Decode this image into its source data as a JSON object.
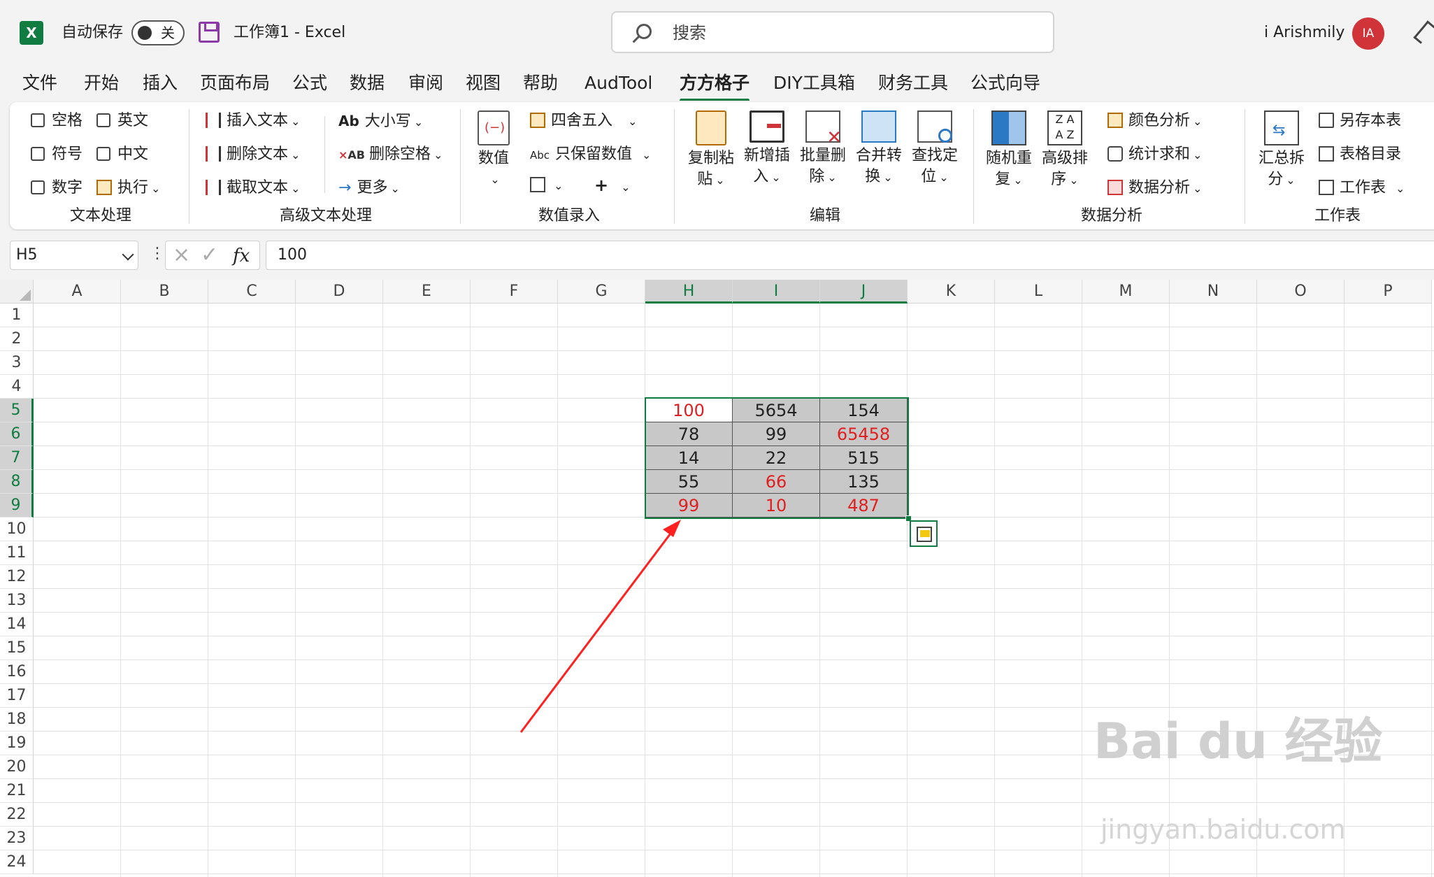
{
  "title_bar": {
    "app_icon": "excel-icon",
    "autosave_label": "自动保存",
    "autosave_state": "关",
    "doc_title": "工作簿1  -  Excel",
    "search_placeholder": "搜索",
    "user_name": "i Arishmily",
    "avatar_initials": "IA",
    "avatar_color": "#d13438"
  },
  "menu_tabs": [
    "文件",
    "开始",
    "插入",
    "页面布局",
    "公式",
    "数据",
    "审阅",
    "视图",
    "帮助",
    "AudTool",
    "方方格子",
    "DIY工具箱",
    "财务工具",
    "公式向导"
  ],
  "active_tab": "方方格子",
  "ribbon": {
    "text_processing": {
      "checkboxes": [
        "空格",
        "英文",
        "符号",
        "中文",
        "数字"
      ],
      "execute": "执行",
      "group_label": "文本处理"
    },
    "advanced_text": {
      "insert_text": "插入文本",
      "delete_text": "删除文本",
      "extract_text": "截取文本",
      "case": "大小写",
      "delete_spaces": "删除空格",
      "more": "更多",
      "group_label": "高级文本处理"
    },
    "number_entry": {
      "number": "数值",
      "round": "四舍五入",
      "keep_number": "只保留数值",
      "group_label": "数值录入"
    },
    "edit": {
      "copy_paste_a": "复制粘",
      "copy_paste_b": "贴",
      "add_insert_a": "新增插",
      "add_insert_b": "入",
      "batch_delete_a": "批量删",
      "batch_delete_b": "除",
      "merge_a": "合并转",
      "merge_b": "换",
      "find_a": "查找定",
      "find_b": "位",
      "group_label": "编辑"
    },
    "data_analysis": {
      "random_a": "随机重",
      "random_b": "复",
      "sort_a": "高级排",
      "sort_b": "序",
      "color_analysis": "颜色分析",
      "stat_sum": "统计求和",
      "data_analysis": "数据分析",
      "group_label": "数据分析"
    },
    "worksheet": {
      "summary_a": "汇总拆",
      "summary_b": "分",
      "save_sheet": "另存本表",
      "sheet_index": "表格目录",
      "worksheet": "工作表",
      "group_label": "工作表"
    }
  },
  "formula_bar": {
    "name_box": "H5",
    "value": "100"
  },
  "columns": [
    "A",
    "B",
    "C",
    "D",
    "E",
    "F",
    "G",
    "H",
    "I",
    "J",
    "K",
    "L",
    "M",
    "N",
    "O",
    "P"
  ],
  "rows": [
    "1",
    "2",
    "3",
    "4",
    "5",
    "6",
    "7",
    "8",
    "9",
    "10",
    "11",
    "12",
    "13",
    "14",
    "15",
    "16",
    "17",
    "18",
    "19",
    "20",
    "21",
    "22",
    "23",
    "24"
  ],
  "selected_range": "H5:J9",
  "cells": [
    {
      "ref": "H5",
      "value": "100",
      "color": "#e02020"
    },
    {
      "ref": "I5",
      "value": "5654",
      "color": "#222222"
    },
    {
      "ref": "J5",
      "value": "154",
      "color": "#222222"
    },
    {
      "ref": "H6",
      "value": "78",
      "color": "#222222"
    },
    {
      "ref": "I6",
      "value": "99",
      "color": "#222222"
    },
    {
      "ref": "J6",
      "value": "65458",
      "color": "#e02020"
    },
    {
      "ref": "H7",
      "value": "14",
      "color": "#222222"
    },
    {
      "ref": "I7",
      "value": "22",
      "color": "#222222"
    },
    {
      "ref": "J7",
      "value": "515",
      "color": "#222222"
    },
    {
      "ref": "H8",
      "value": "55",
      "color": "#222222"
    },
    {
      "ref": "I8",
      "value": "66",
      "color": "#e02020"
    },
    {
      "ref": "J8",
      "value": "135",
      "color": "#222222"
    },
    {
      "ref": "H9",
      "value": "99",
      "color": "#e02020"
    },
    {
      "ref": "I9",
      "value": "10",
      "color": "#e02020"
    },
    {
      "ref": "J9",
      "value": "487",
      "color": "#e02020"
    }
  ],
  "colors": {
    "accent": "#107c41",
    "selection_fill": "#c8c8c8",
    "annotation_arrow": "#ff2020"
  },
  "watermark": {
    "main": "Bai du 经验",
    "sub": "jingyan.baidu.com"
  }
}
